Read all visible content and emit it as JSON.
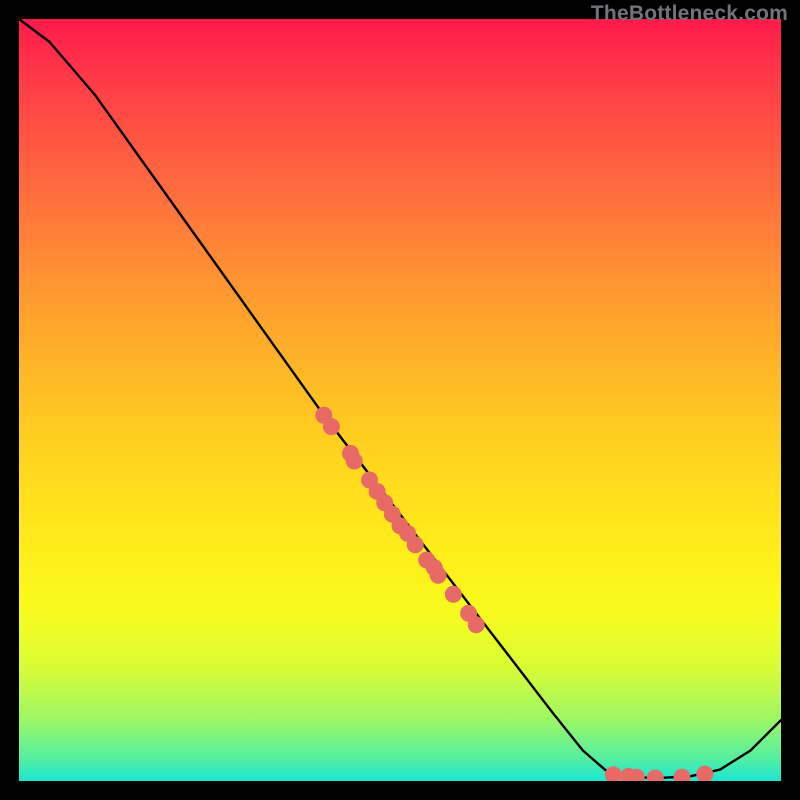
{
  "attribution": "TheBottleneck.com",
  "colors": {
    "curve": "#000000",
    "dots": "#e86a66",
    "dots_stroke": "#c54c4c"
  },
  "chart_data": {
    "type": "line",
    "title": "",
    "xlabel": "",
    "ylabel": "",
    "xlim": [
      0,
      100
    ],
    "ylim": [
      0,
      100
    ],
    "series": [
      {
        "name": "curve",
        "x": [
          0,
          4,
          7,
          10,
          15,
          20,
          30,
          40,
          50,
          60,
          65,
          70,
          74,
          77,
          80,
          84,
          88,
          92,
          96,
          100
        ],
        "y": [
          100,
          97,
          93.5,
          90,
          83,
          76,
          62,
          48,
          35,
          22,
          15.5,
          9,
          4,
          1.4,
          0.5,
          0.4,
          0.6,
          1.5,
          4,
          8
        ]
      }
    ],
    "scatter": {
      "name": "dots",
      "points": [
        {
          "x": 40,
          "y": 48
        },
        {
          "x": 41,
          "y": 46.5
        },
        {
          "x": 43.5,
          "y": 43
        },
        {
          "x": 44,
          "y": 42
        },
        {
          "x": 46,
          "y": 39.5
        },
        {
          "x": 47,
          "y": 38
        },
        {
          "x": 48,
          "y": 36.5
        },
        {
          "x": 49,
          "y": 35
        },
        {
          "x": 50,
          "y": 33.5
        },
        {
          "x": 51,
          "y": 32.5
        },
        {
          "x": 52,
          "y": 31
        },
        {
          "x": 53.5,
          "y": 29
        },
        {
          "x": 54.5,
          "y": 28
        },
        {
          "x": 55,
          "y": 27
        },
        {
          "x": 57,
          "y": 24.5
        },
        {
          "x": 59,
          "y": 22
        },
        {
          "x": 60,
          "y": 20.5
        },
        {
          "x": 78,
          "y": 0.8
        },
        {
          "x": 80,
          "y": 0.6
        },
        {
          "x": 81,
          "y": 0.5
        },
        {
          "x": 83.5,
          "y": 0.4
        },
        {
          "x": 87,
          "y": 0.5
        },
        {
          "x": 90,
          "y": 0.9
        }
      ]
    }
  }
}
